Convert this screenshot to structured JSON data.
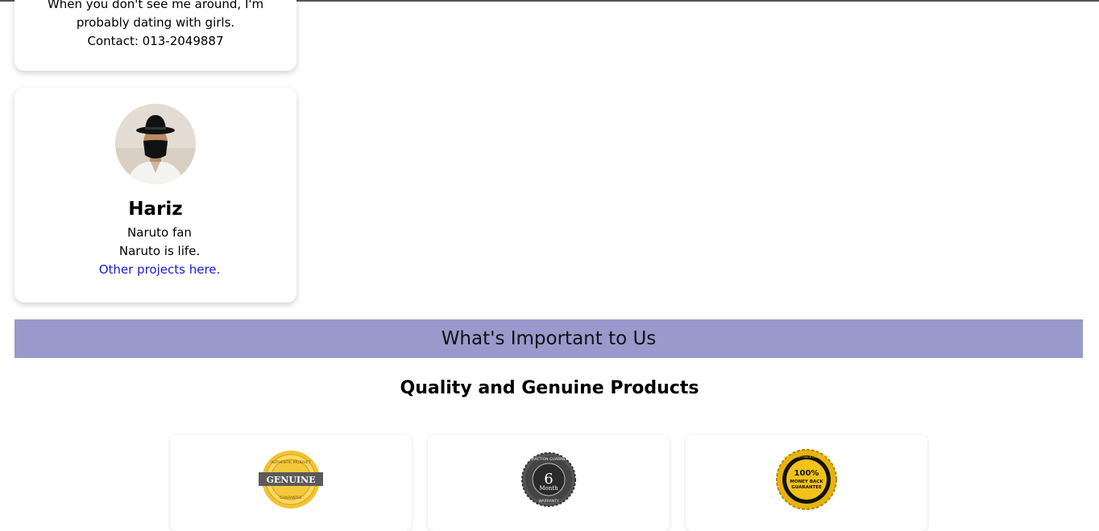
{
  "team_cards": [
    {
      "bio_line1": "When you don't see me around, I'm",
      "bio_line2": "probably dating with girls.",
      "contact": "Contact: 013-2049887"
    },
    {
      "name": "Hariz",
      "line1": "Naruto fan",
      "line2": "Naruto is life.",
      "link_text": "Other projects here."
    }
  ],
  "banner": {
    "title": "What's Important to Us"
  },
  "section": {
    "heading": "Quality and Genuine Products"
  },
  "features": [
    {
      "icon": "genuine-badge-icon",
      "badge_text": "GENUINE",
      "ring_top": "AUTHENTIC PRODUCT",
      "ring_bottom": "GUARANTEE"
    },
    {
      "icon": "six-month-warranty-icon",
      "badge_number": "6",
      "badge_unit": "Month",
      "ring_top": "SATISFACTION GUARANTEED",
      "ring_bottom": "WARRANTY"
    },
    {
      "icon": "money-back-guarantee-icon",
      "badge_line1": "100%",
      "badge_line2": "MONEY BACK",
      "badge_line3": "GUARANTEE",
      "ring_text": "100% MONEY BACK GUARANTEE"
    }
  ],
  "colors": {
    "banner_bg": "#9999cc",
    "link": "#1a1ad6"
  }
}
